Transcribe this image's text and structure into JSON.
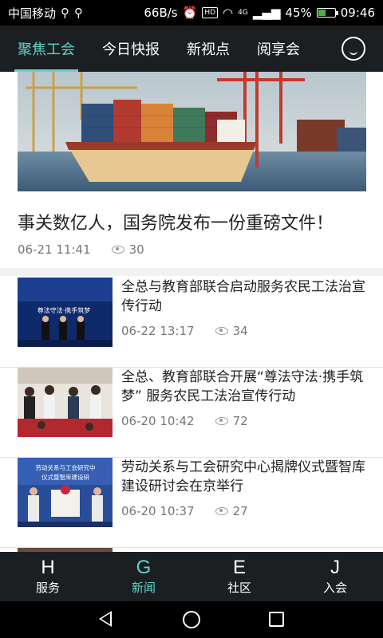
{
  "status_bar": {
    "carrier": "中国移动",
    "speed": "66B/s",
    "hd": "HD",
    "network": "4G",
    "battery_percent": "45%",
    "battery_level": 0.45,
    "time": "09:46"
  },
  "top_tabs": [
    "聚焦工会",
    "今日快报",
    "新视点",
    "阅享会"
  ],
  "hero": {
    "title": "事关数亿人，国务院发布一份重磅文件！",
    "date": "06-21 11:41",
    "views": "30"
  },
  "news": [
    {
      "title": "全总与教育部联合启动服务农民工法治宣传行动",
      "date": "06-22 13:17",
      "views": "34"
    },
    {
      "title": "全总、教育部联合开展“尊法守法·携手筑梦” 服务农民工法治宣传行动",
      "date": "06-20 10:42",
      "views": "72"
    },
    {
      "title": "劳动关系与工会研究中心揭牌仪式暨智库建设研讨会在京举行",
      "date": "06-20 10:37",
      "views": "27"
    }
  ],
  "bottom_nav": [
    {
      "glyph": "H",
      "label": "服务"
    },
    {
      "glyph": "G",
      "label": "新闻"
    },
    {
      "glyph": "E",
      "label": "社区"
    },
    {
      "glyph": "J",
      "label": "入会"
    }
  ],
  "colors": {
    "accent": "#5ed6c6",
    "bar_bg": "#1b1f22"
  }
}
